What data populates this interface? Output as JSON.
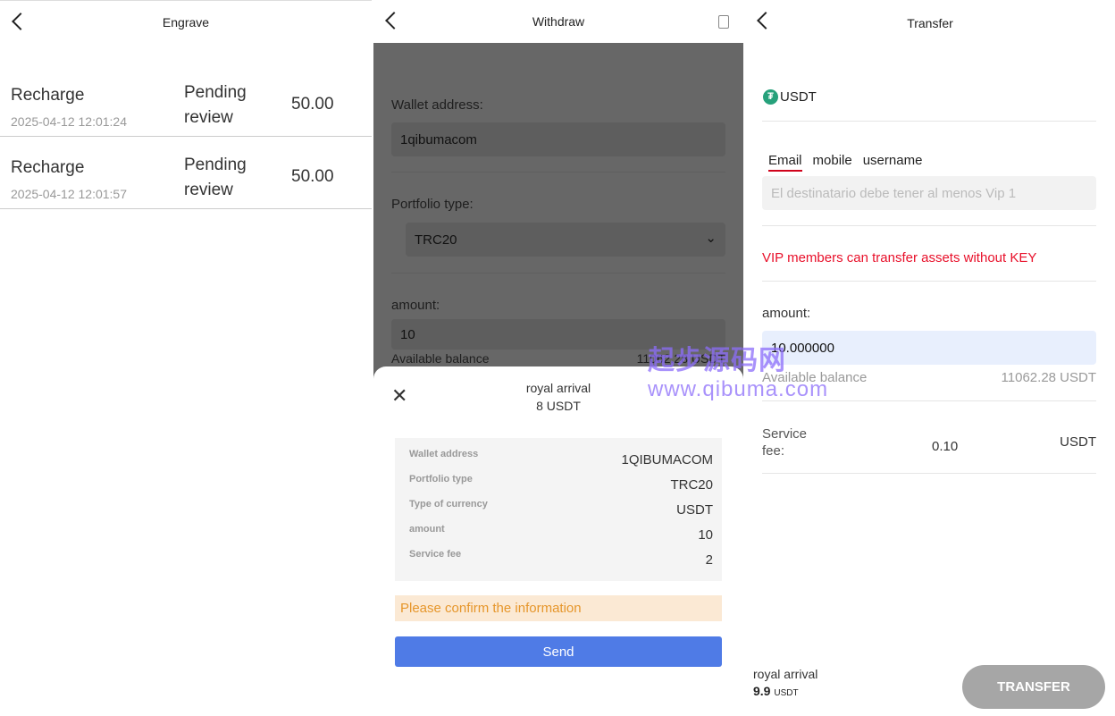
{
  "engrave": {
    "title": "Engrave",
    "records": [
      {
        "type": "Recharge",
        "date": "2025-04-12 12:01:24",
        "status": "Pending review",
        "amount": "50.00"
      },
      {
        "type": "Recharge",
        "date": "2025-04-12 12:01:57",
        "status": "Pending review",
        "amount": "50.00"
      }
    ]
  },
  "withdraw": {
    "title": "Withdraw",
    "wallet_label": "Wallet address:",
    "wallet_value": "1qibumacom",
    "portfolio_label": "Portfolio type:",
    "portfolio_value": "TRC20",
    "amount_label": "amount:",
    "amount_value": "10",
    "available_label": "Available balance",
    "available_value": "11062.28 USDT",
    "sheet": {
      "title": "royal arrival",
      "amount": "8 USDT",
      "rows": [
        {
          "k": "Wallet address",
          "v": "1QIBUMACOM"
        },
        {
          "k": "Portfolio type",
          "v": "TRC20"
        },
        {
          "k": "Type of currency",
          "v": "USDT"
        },
        {
          "k": "amount",
          "v": "10"
        },
        {
          "k": "Service fee",
          "v": "2"
        }
      ],
      "warning": "Please confirm the information",
      "send": "Send"
    }
  },
  "transfer": {
    "title": "Transfer",
    "currency": "USDT",
    "tabs": [
      "Email",
      "mobile",
      "username"
    ],
    "recipient_placeholder": "El destinatario debe tener al menos Vip 1",
    "vip_note": "VIP members can transfer assets without KEY",
    "amount_label": "amount:",
    "amount_value": "10.000000",
    "available_label": "Available balance",
    "available_value": "11062.28 USDT",
    "fee_label": "Service fee:",
    "fee_value": "0.10",
    "fee_unit": "USDT",
    "arrival_label": "royal arrival",
    "arrival_value": "9.9",
    "arrival_unit": "USDT",
    "button": "TRANSFER",
    "accent": "#d0021b"
  },
  "watermark": {
    "cn": "起步源码网",
    "url": "www.qibuma.com"
  }
}
